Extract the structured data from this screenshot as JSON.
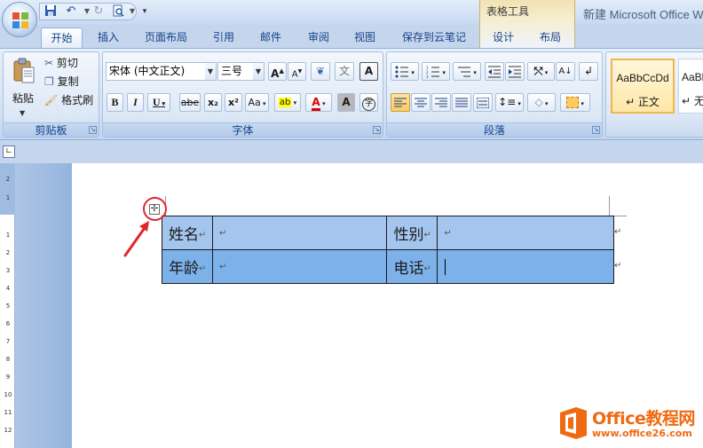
{
  "title_bar": {
    "contextual_tab_group": "表格工具",
    "document_title": "新建 Microsoft Office W"
  },
  "quick_access": {
    "icons": [
      "save-icon",
      "undo-icon",
      "redo-icon",
      "print-preview-icon",
      "customize-icon"
    ]
  },
  "tabs": [
    "开始",
    "插入",
    "页面布局",
    "引用",
    "邮件",
    "审阅",
    "视图",
    "保存到云笔记",
    "设计",
    "布局"
  ],
  "active_tab": "开始",
  "ribbon": {
    "clipboard": {
      "label": "剪贴板",
      "paste": "粘贴",
      "cut": "剪切",
      "copy": "复制",
      "format_painter": "格式刷"
    },
    "font": {
      "label": "字体",
      "font_name": "宋体 (中文正文)",
      "font_size": "三号",
      "grow": "A",
      "shrink": "A",
      "phonetic": "文",
      "border_char": "A",
      "bold": "B",
      "italic": "I",
      "underline": "U",
      "strikethrough": "abe",
      "subscript": "x₂",
      "superscript": "x²",
      "change_case": "Aa",
      "highlight": "ab",
      "font_color": "A",
      "char_shading": "A",
      "enclose": "字"
    },
    "paragraph": {
      "label": "段落"
    },
    "styles": {
      "items": [
        {
          "sample": "AaBbCcDd",
          "name": "↵ 正文"
        },
        {
          "sample": "AaBb",
          "name": "↵ 无"
        }
      ]
    }
  },
  "table": {
    "rows": [
      [
        "姓名",
        "",
        "性别",
        ""
      ],
      [
        "年龄",
        "",
        "电话",
        ""
      ]
    ],
    "para_mark": "↵"
  },
  "vruler_labels": [
    "2",
    "1",
    "1",
    "2",
    "3",
    "4",
    "5",
    "6",
    "7",
    "8",
    "9",
    "10",
    "11",
    "12"
  ],
  "watermark": {
    "name": "Office教程网",
    "url": "www.office26.com"
  },
  "colors": {
    "row1": "#a4c6ee",
    "row2": "#7db1ea",
    "annotation": "#e0252c",
    "watermark": "#f06a12"
  }
}
